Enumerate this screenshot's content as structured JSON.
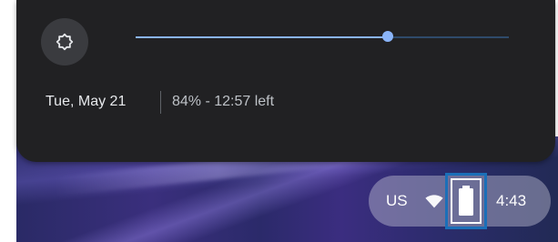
{
  "quick_settings": {
    "brightness": {
      "icon": "brightness-icon",
      "level": 0.675
    },
    "date": "Tue, May 21",
    "battery_status": "84% - 12:57 left"
  },
  "status_tray": {
    "language": "US",
    "wifi_icon": "wifi-icon",
    "battery_icon": "battery-icon",
    "battery_level": 0.84,
    "time": "4:43"
  },
  "colors": {
    "panel_bg": "#212123",
    "accent": "#8ab4f8",
    "highlight_box": "#1b6fb8"
  }
}
